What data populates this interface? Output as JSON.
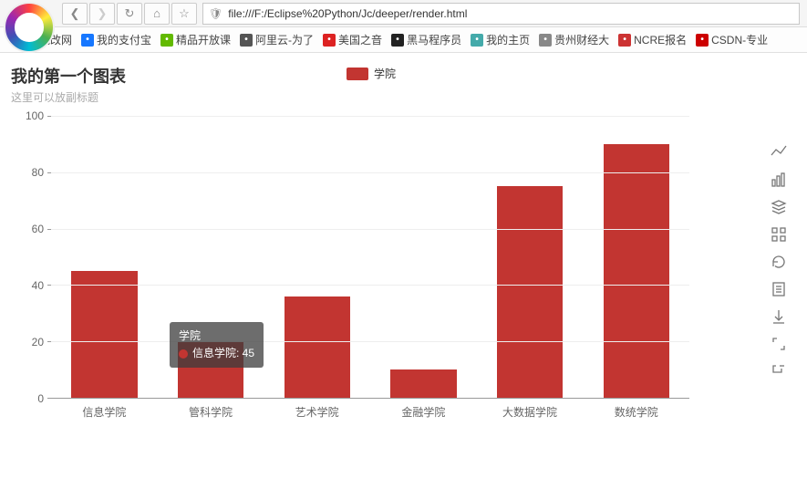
{
  "browser": {
    "url": "file:///F:/Eclipse%20Python/Jc/deeper/render.html",
    "bookmarks": [
      {
        "label": "批改网",
        "color": "#f0a030"
      },
      {
        "label": "我的支付宝",
        "color": "#1677ff"
      },
      {
        "label": "精品开放课",
        "color": "#62b900"
      },
      {
        "label": "阿里云-为了",
        "color": "#555"
      },
      {
        "label": "美国之音",
        "color": "#d22"
      },
      {
        "label": "黑马程序员",
        "color": "#222"
      },
      {
        "label": "我的主页",
        "color": "#4aa"
      },
      {
        "label": "贵州财经大",
        "color": "#888"
      },
      {
        "label": "NCRE报名",
        "color": "#c33"
      },
      {
        "label": "CSDN-专业",
        "color": "#c00"
      }
    ]
  },
  "chart_data": {
    "type": "bar",
    "title": "我的第一个图表",
    "subtitle": "这里可以放副标题",
    "legend": "学院",
    "categories": [
      "信息学院",
      "管科学院",
      "艺术学院",
      "金融学院",
      "大数据学院",
      "数统学院"
    ],
    "series": [
      {
        "name": "学院",
        "values": [
          45,
          20,
          36,
          10,
          75,
          90
        ]
      }
    ],
    "ylim": [
      0,
      100
    ],
    "y_ticks": [
      0,
      20,
      40,
      60,
      80,
      100
    ],
    "xlabel": "",
    "ylabel": ""
  },
  "tooltip": {
    "series": "学院",
    "label": "信息学院: 45"
  }
}
